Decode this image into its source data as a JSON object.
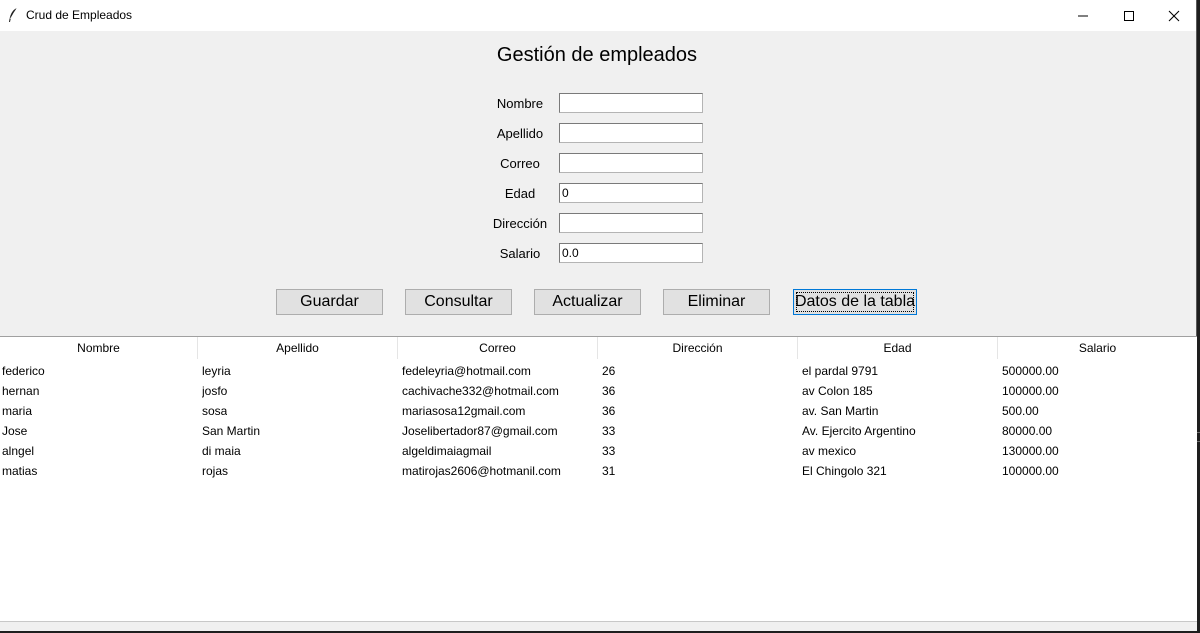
{
  "window": {
    "title": "Crud de Empleados",
    "icon": "feather-icon"
  },
  "form": {
    "heading": "Gestión de empleados",
    "fields": [
      {
        "label": "Nombre",
        "value": ""
      },
      {
        "label": "Apellido",
        "value": ""
      },
      {
        "label": "Correo",
        "value": ""
      },
      {
        "label": "Edad",
        "value": "0"
      },
      {
        "label": "Dirección",
        "value": ""
      },
      {
        "label": "Salario",
        "value": "0.0"
      }
    ]
  },
  "buttons": {
    "guardar": "Guardar",
    "consultar": "Consultar",
    "actualizar": "Actualizar",
    "eliminar": "Eliminar",
    "datos": "Datos de la tabla"
  },
  "table": {
    "columns": [
      "Nombre",
      "Apellido",
      "Correo",
      "Dirección",
      "Edad",
      "Salario"
    ],
    "rows": [
      [
        "federico",
        "leyria",
        "fedeleyria@hotmail.com",
        "26",
        "el pardal 9791",
        "500000.00"
      ],
      [
        "hernan",
        "josfo",
        "cachivache332@hotmail.com",
        "36",
        "av Colon 185",
        "100000.00"
      ],
      [
        "maria",
        "sosa",
        "mariasosa12gmail.com",
        "36",
        "av. San Martin",
        "500.00"
      ],
      [
        "Jose",
        "San Martin",
        "Joselibertador87@gmail.com",
        "33",
        "Av. Ejercito Argentino",
        "80000.00"
      ],
      [
        "alngel",
        "di maia",
        "algeldimaiagmail",
        "33",
        "av mexico",
        "130000.00"
      ],
      [
        "matias",
        "rojas",
        "matirojas2606@hotmanil.com",
        "31",
        "El Chingolo 321",
        "100000.00"
      ]
    ]
  }
}
